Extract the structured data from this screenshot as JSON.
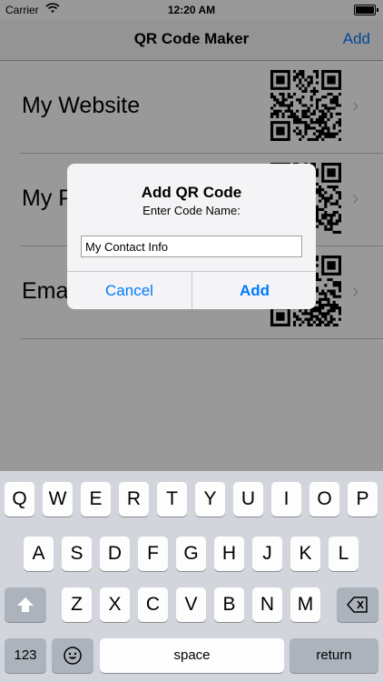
{
  "status_bar": {
    "carrier": "Carrier",
    "wifi_icon": "wifi-icon",
    "time": "12:20 AM",
    "battery_icon": "battery-icon"
  },
  "nav": {
    "title": "QR Code Maker",
    "add_label": "Add"
  },
  "list": {
    "items": [
      {
        "label": "My Website",
        "icon": "qr-code-icon"
      },
      {
        "label": "My P",
        "icon": "qr-code-icon"
      },
      {
        "label": "Ema",
        "icon": "qr-code-icon"
      }
    ]
  },
  "alert": {
    "title": "Add QR Code",
    "message": "Enter Code Name:",
    "input_value": "My Contact Info",
    "cancel_label": "Cancel",
    "add_label": "Add"
  },
  "keyboard": {
    "row1": [
      "Q",
      "W",
      "E",
      "R",
      "T",
      "Y",
      "U",
      "I",
      "O",
      "P"
    ],
    "row2": [
      "A",
      "S",
      "D",
      "F",
      "G",
      "H",
      "J",
      "K",
      "L"
    ],
    "row3": [
      "Z",
      "X",
      "C",
      "V",
      "B",
      "N",
      "M"
    ],
    "numbers_label": "123",
    "space_label": "space",
    "return_label": "return",
    "shift_icon": "shift-icon",
    "delete_icon": "delete-icon",
    "emoji_icon": "emoji-icon"
  },
  "colors": {
    "accent": "#007aff",
    "keyboard_background": "#d2d5db",
    "key_dark": "#acb3bc"
  }
}
